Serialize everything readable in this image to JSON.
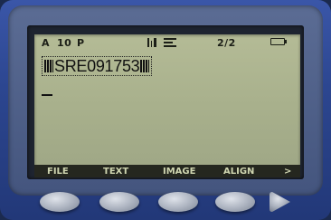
{
  "status": {
    "font": "A",
    "size": "10",
    "style": "P",
    "page": "2/2"
  },
  "label": {
    "text": "SRE091753"
  },
  "softkeys": {
    "key1": "FILE",
    "key2": "TEXT",
    "key3": "IMAGE",
    "key4": "ALIGN",
    "key5": ">"
  },
  "colors": {
    "lcd": "#a8b08c",
    "lcd_text": "#1c1f17",
    "softkey_bar": "#25271f",
    "case": "#2c4690"
  },
  "icons": {
    "indicator_a": "barcode-alignment-icon",
    "indicator_b": "text-align-icon",
    "battery": "battery-icon",
    "next": "play-arrow-icon"
  }
}
